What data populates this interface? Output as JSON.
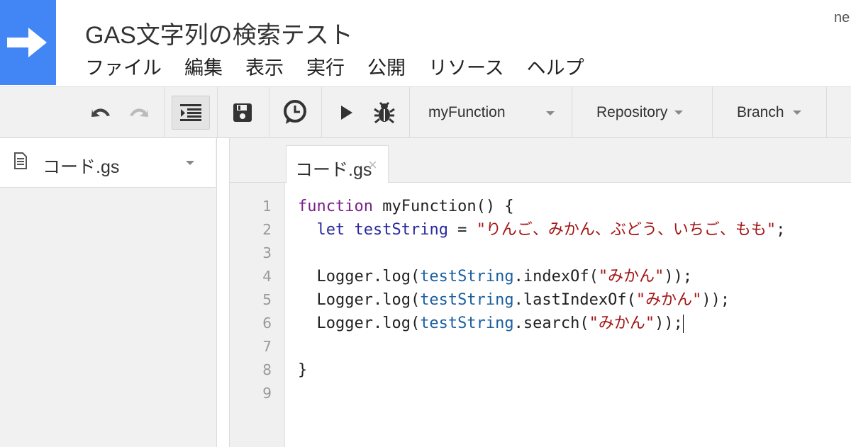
{
  "header": {
    "title": "GAS文字列の検索テスト",
    "user_partial": "ne",
    "logo_icon": "arrow-right-icon",
    "menu": [
      "ファイル",
      "編集",
      "表示",
      "実行",
      "公開",
      "リソース",
      "ヘルプ"
    ]
  },
  "toolbar": {
    "icons": [
      "undo-icon",
      "redo-icon",
      "indent-icon",
      "save-icon",
      "triggers-clock-icon",
      "run-icon",
      "debug-bug-icon"
    ],
    "function_select": "myFunction",
    "repository_label": "Repository",
    "branch_label": "Branch"
  },
  "sidebar": {
    "files": [
      {
        "name": "コード.gs",
        "icon": "document-icon"
      }
    ]
  },
  "editor": {
    "tab": {
      "label": "コード.gs",
      "close": "×"
    },
    "line_numbers": [
      "1",
      "2",
      "3",
      "4",
      "5",
      "6",
      "7",
      "8",
      "9"
    ],
    "lines": [
      [
        {
          "t": "function",
          "c": "kw"
        },
        {
          "t": " myFunction() {",
          "c": "plain"
        }
      ],
      [
        {
          "t": "  let",
          "c": "kw2"
        },
        {
          "t": " ",
          "c": "plain"
        },
        {
          "t": "testString",
          "c": "kw2"
        },
        {
          "t": " = ",
          "c": "plain"
        },
        {
          "t": "\"りんご、みかん、ぶどう、いちご、もも\"",
          "c": "str"
        },
        {
          "t": ";",
          "c": "plain"
        }
      ],
      [],
      [
        {
          "t": "  Logger.log(",
          "c": "plain"
        },
        {
          "t": "testString",
          "c": "var"
        },
        {
          "t": ".indexOf(",
          "c": "plain"
        },
        {
          "t": "\"みかん\"",
          "c": "str"
        },
        {
          "t": "));",
          "c": "plain"
        }
      ],
      [
        {
          "t": "  Logger.log(",
          "c": "plain"
        },
        {
          "t": "testString",
          "c": "var"
        },
        {
          "t": ".lastIndexOf(",
          "c": "plain"
        },
        {
          "t": "\"みかん\"",
          "c": "str"
        },
        {
          "t": "));",
          "c": "plain"
        }
      ],
      [
        {
          "t": "  Logger.log(",
          "c": "plain"
        },
        {
          "t": "testString",
          "c": "var"
        },
        {
          "t": ".search(",
          "c": "plain"
        },
        {
          "t": "\"みかん\"",
          "c": "str"
        },
        {
          "t": "));",
          "c": "plain"
        }
      ],
      [],
      [
        {
          "t": "}",
          "c": "plain"
        }
      ],
      []
    ],
    "cursor_line": 6
  }
}
